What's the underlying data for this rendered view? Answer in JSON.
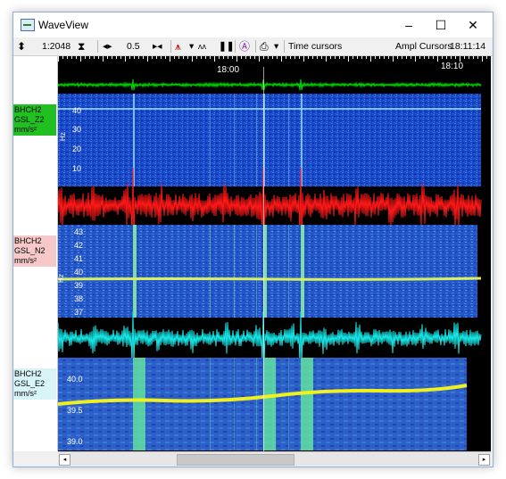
{
  "window": {
    "title": "WaveView",
    "minimize_glyph": "–",
    "maximize_glyph": "☐",
    "close_glyph": "✕"
  },
  "toolbar": {
    "zoom_icon": "⬍",
    "zoom_value": "1:2048",
    "hourglass_icon": "⧗",
    "hspread_icon": "◂▸",
    "time_scale": "0.5",
    "hshrink_icon": "▸◂",
    "filter_icon": "⩚",
    "dropdown_glyph": "▾",
    "wave_icon": "ʌʌ",
    "pause_icon": "❚❚",
    "spectro_icon": "Ⓐ",
    "print_icon": "⎙",
    "time_cursors_label": "Time cursors",
    "ampl_cursors_label": "Ampl Cursors",
    "clock": "18:11:14"
  },
  "time_axis": {
    "tick_18_00": "18:00",
    "tick_18_10": "18:10"
  },
  "channels": [
    {
      "line1": "BHCH2",
      "line2": "GSL_Z2",
      "unit": "mm/s²",
      "bg": "#20c020",
      "wave_color": "#00e000",
      "freq_ticks": [
        "40",
        "30",
        "20",
        "10"
      ],
      "freq_unit": "Hz"
    },
    {
      "line1": "BHCH2",
      "line2": "GSL_N2",
      "unit": "mm/s²",
      "bg": "#f7c8c8",
      "wave_color": "#ff1818",
      "freq_ticks": [
        "43",
        "42",
        "41",
        "40",
        "39",
        "38",
        "37"
      ],
      "freq_unit": "Hz"
    },
    {
      "line1": "BHCH2",
      "line2": "GSL_E2",
      "unit": "mm/s²",
      "bg": "#d8f4f8",
      "wave_color": "#18e8e8",
      "freq_ticks": [
        "40.0",
        "39.5",
        "39.0"
      ],
      "freq_unit": "Hz"
    }
  ],
  "scroll": {
    "left_glyph": "◂",
    "right_glyph": "▸"
  }
}
